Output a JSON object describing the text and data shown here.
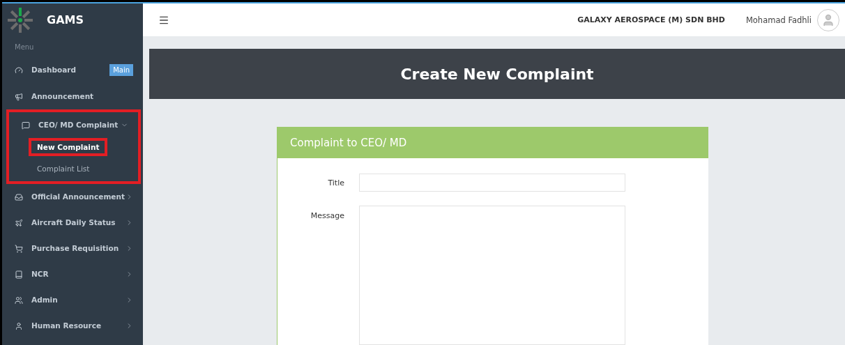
{
  "sidebar": {
    "brand": "GAMS",
    "section_label": "Menu",
    "items": [
      {
        "label": "Dashboard",
        "badge": "Main",
        "expandable": false,
        "highlighted": false
      },
      {
        "label": "Announcement",
        "expandable": false,
        "highlighted": false
      },
      {
        "label": "CEO/ MD Complaint",
        "expandable": true,
        "expanded": true,
        "highlighted": true,
        "children": [
          {
            "label": "New Complaint",
            "selected": true,
            "highlighted": true
          },
          {
            "label": "Complaint List",
            "selected": false,
            "highlighted": false
          }
        ]
      },
      {
        "label": "Official Announcement",
        "expandable": true,
        "expanded": false,
        "highlighted": false
      },
      {
        "label": "Aircraft Daily Status",
        "expandable": true,
        "expanded": false,
        "highlighted": false
      },
      {
        "label": "Purchase Requisition",
        "expandable": true,
        "expanded": false,
        "highlighted": false
      },
      {
        "label": "NCR",
        "expandable": true,
        "expanded": false,
        "highlighted": false
      },
      {
        "label": "Admin",
        "expandable": true,
        "expanded": false,
        "highlighted": false
      },
      {
        "label": "Human Resource",
        "expandable": true,
        "expanded": false,
        "highlighted": false
      }
    ]
  },
  "topbar": {
    "company": "GALAXY AEROSPACE (M) SDN BHD",
    "user": "Mohamad Fadhli"
  },
  "page_title": "Create New Complaint",
  "form": {
    "heading": "Complaint to CEO/ MD",
    "fields": [
      {
        "label": "Title",
        "kind": "text"
      },
      {
        "label": "Message",
        "kind": "textarea"
      }
    ]
  }
}
